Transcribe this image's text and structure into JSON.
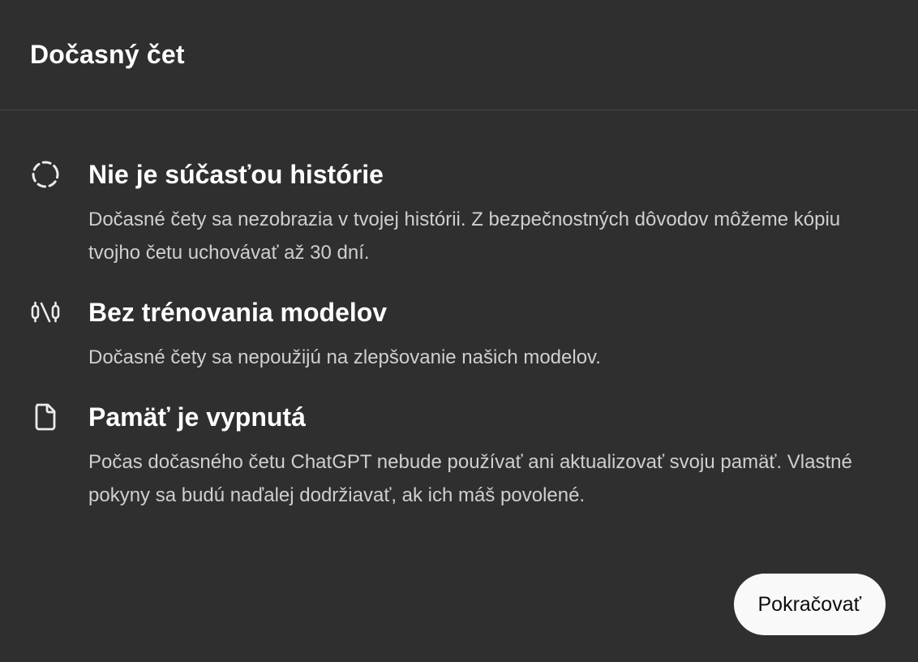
{
  "dialog": {
    "title": "Dočasný čet"
  },
  "features": [
    {
      "icon": "dashed-circle-icon",
      "heading": "Nie je súčasťou histórie",
      "description": "Dočasné čety sa nezobrazia v tvojej histórii. Z bezpečnostných dôvodov môžeme kópiu tvojho četu uchovávať až 30 dní."
    },
    {
      "icon": "no-training-icon",
      "heading": "Bez trénovania modelov",
      "description": "Dočasné čety sa nepoužijú na zlepšovanie našich modelov."
    },
    {
      "icon": "document-icon",
      "heading": "Pamäť je vypnutá",
      "description": "Počas dočasného četu ChatGPT nebude používať ani aktualizovať svoju pamäť. Vlastné pokyny sa budú naďalej dodržiavať, ak ich máš povolené."
    }
  ],
  "actions": {
    "continue_label": "Pokračovať"
  },
  "colors": {
    "background": "#2f2f2f",
    "divider": "#4a4a4a",
    "heading": "#ffffff",
    "body_text": "#cfcfcf",
    "button_bg": "#f9f9f9",
    "button_text": "#0d0d0d"
  }
}
